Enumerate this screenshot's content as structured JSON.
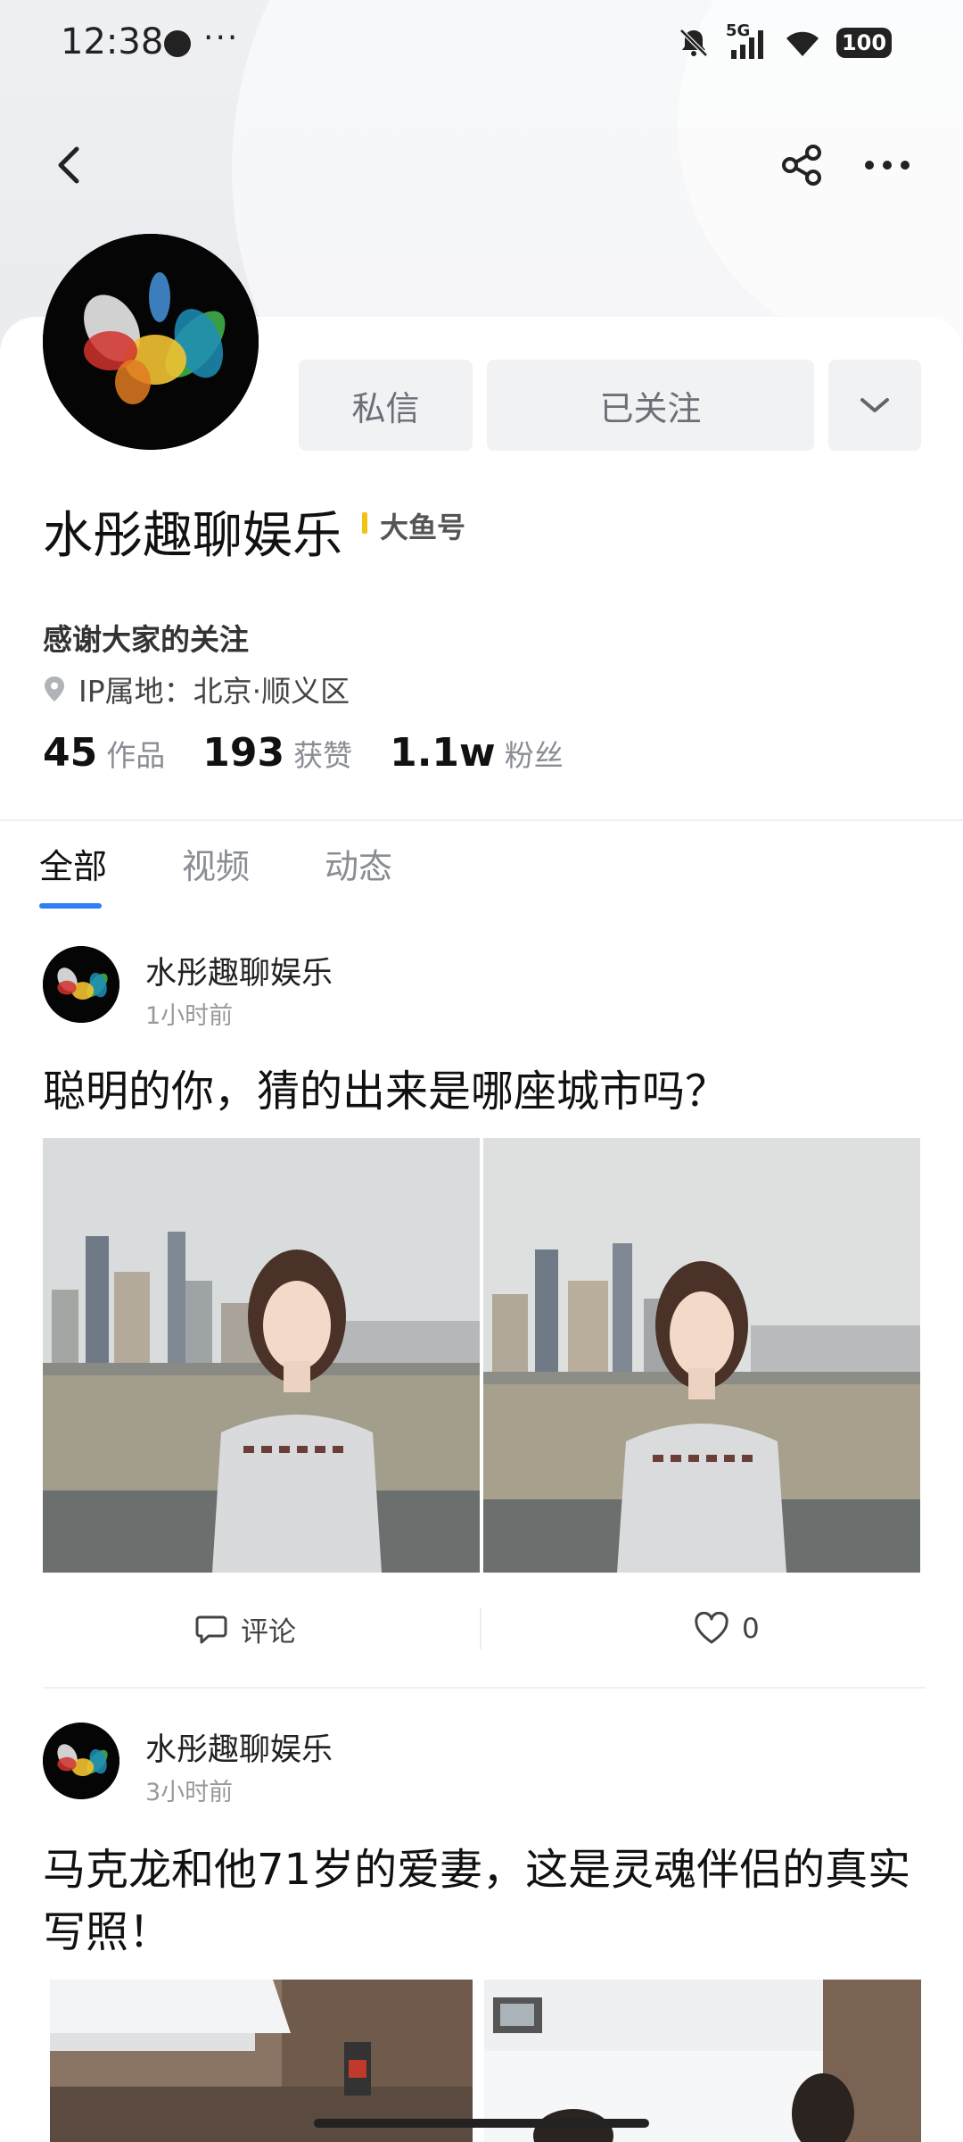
{
  "status_bar": {
    "time": "12:38",
    "dots": "···",
    "network": "5G",
    "battery": "100"
  },
  "profile": {
    "name": "水彤趣聊娱乐",
    "badge": "大鱼号",
    "bio": "感谢大家的关注",
    "ip_location": "IP属地：北京·顺义区",
    "buttons": {
      "message": "私信",
      "follow": "已关注"
    },
    "stats": [
      {
        "num": "45",
        "label": "作品"
      },
      {
        "num": "193",
        "label": "获赞"
      },
      {
        "num": "1.1w",
        "label": "粉丝"
      }
    ]
  },
  "tabs": [
    {
      "label": "全部",
      "active": true
    },
    {
      "label": "视频",
      "active": false
    },
    {
      "label": "动态",
      "active": false
    }
  ],
  "posts": [
    {
      "author": "水彤趣聊娱乐",
      "time": "1小时前",
      "title": "聪明的你，猜的出来是哪座城市吗？",
      "comment_label": "评论",
      "like_count": "0"
    },
    {
      "author": "水彤趣聊娱乐",
      "time": "3小时前",
      "title": "马克龙和他71岁的爱妻，这是灵魂伴侣的真实写照！"
    }
  ],
  "icons": {
    "back": "chevron-left-icon",
    "share": "share-icon",
    "more": "more-horizontal-icon",
    "location": "location-pin-icon",
    "comment": "comment-icon",
    "like": "heart-icon"
  },
  "colors": {
    "accent": "#2d7ef7",
    "badge_bar": "#f2c21a",
    "button_bg": "#f1f2f4"
  }
}
